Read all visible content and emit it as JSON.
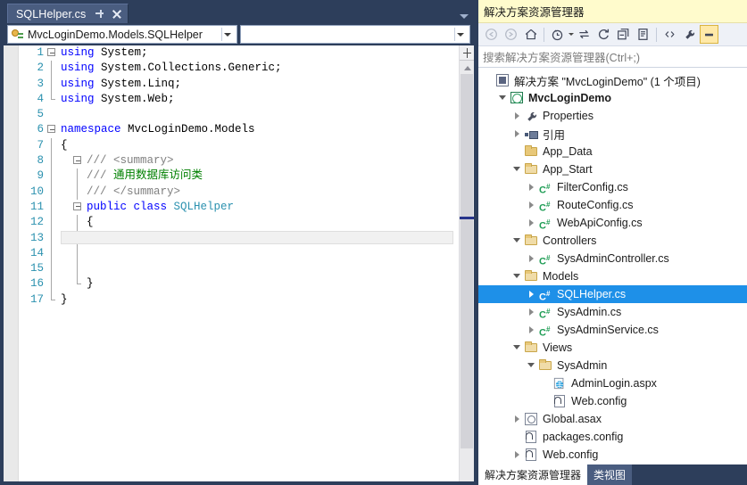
{
  "editor": {
    "tab": {
      "label": "SQLHelper.cs",
      "pin_icon": "pin-icon",
      "close_icon": "close-icon"
    },
    "tabstrip_menu_icon": "chevron-down-icon",
    "nav": {
      "type_combo_value": "MvcLoginDemo.Models.SQLHelper",
      "type_combo_icon": "class-icon",
      "member_combo_value": ""
    },
    "lines": [
      {
        "n": "1",
        "fold": "box",
        "segs": [
          {
            "t": "using ",
            "c": "k"
          },
          {
            "t": "System;",
            "c": "p"
          }
        ]
      },
      {
        "n": "2",
        "fold": "line",
        "segs": [
          {
            "t": "using ",
            "c": "k"
          },
          {
            "t": "System.Collections.Generic;",
            "c": "p"
          }
        ]
      },
      {
        "n": "3",
        "fold": "line",
        "segs": [
          {
            "t": "using ",
            "c": "k"
          },
          {
            "t": "System.Linq;",
            "c": "p"
          }
        ]
      },
      {
        "n": "4",
        "fold": "endline",
        "segs": [
          {
            "t": "using ",
            "c": "k"
          },
          {
            "t": "System.Web;",
            "c": "p"
          }
        ]
      },
      {
        "n": "5",
        "fold": "none",
        "segs": []
      },
      {
        "n": "6",
        "fold": "box",
        "segs": [
          {
            "t": "namespace ",
            "c": "k"
          },
          {
            "t": "MvcLoginDemo.Models",
            "c": "p"
          }
        ]
      },
      {
        "n": "7",
        "fold": "line",
        "segs": [
          {
            "t": "{",
            "c": "p"
          }
        ]
      },
      {
        "n": "8",
        "fold": "line",
        "indent": 1,
        "inner": "box",
        "segs": [
          {
            "t": "/// ",
            "c": "c"
          },
          {
            "t": "<summary>",
            "c": "c"
          }
        ]
      },
      {
        "n": "9",
        "fold": "line",
        "indent": 1,
        "inner": "line",
        "segs": [
          {
            "t": "/// ",
            "c": "c"
          },
          {
            "t": "通用数据库访问类",
            "c": "cg"
          }
        ]
      },
      {
        "n": "10",
        "fold": "line",
        "indent": 1,
        "inner": "line",
        "segs": [
          {
            "t": "/// ",
            "c": "c"
          },
          {
            "t": "</summary>",
            "c": "c"
          }
        ]
      },
      {
        "n": "11",
        "fold": "line",
        "indent": 1,
        "inner": "box",
        "segs": [
          {
            "t": "public ",
            "c": "k"
          },
          {
            "t": "class ",
            "c": "k"
          },
          {
            "t": "SQLHelper",
            "c": "t"
          }
        ]
      },
      {
        "n": "12",
        "fold": "line",
        "indent": 1,
        "inner": "line",
        "segs": [
          {
            "t": "{",
            "c": "p"
          }
        ]
      },
      {
        "n": "13",
        "fold": "line",
        "indent": 1,
        "inner": "line",
        "current": true,
        "segs": []
      },
      {
        "n": "14",
        "fold": "line",
        "indent": 1,
        "inner": "line",
        "segs": []
      },
      {
        "n": "15",
        "fold": "line",
        "indent": 1,
        "inner": "line",
        "segs": []
      },
      {
        "n": "16",
        "fold": "line",
        "indent": 1,
        "inner": "endline",
        "segs": [
          {
            "t": "}",
            "c": "p"
          }
        ]
      },
      {
        "n": "17",
        "fold": "endline",
        "segs": [
          {
            "t": "}",
            "c": "p"
          }
        ]
      }
    ],
    "scrollbar": {
      "split_icon": "split-view-icon",
      "scroll_up_icon": "scroll-up-arrow-icon",
      "marker_label": "changed-line-marker"
    }
  },
  "solution_explorer": {
    "title": "解决方案资源管理器",
    "toolbar": [
      {
        "name": "back-button",
        "icon": "back-arrow-icon",
        "disabled": true,
        "active": false
      },
      {
        "name": "forward-button",
        "icon": "forward-arrow-icon",
        "disabled": true,
        "active": false
      },
      {
        "name": "home-button",
        "icon": "home-icon",
        "disabled": false,
        "active": false
      },
      {
        "name": "pending-changes-button",
        "icon": "clock-icon",
        "disabled": false,
        "active": false,
        "caret": true
      },
      {
        "name": "sync-with-document-button",
        "icon": "sync-arrows-icon",
        "disabled": false,
        "active": false
      },
      {
        "name": "refresh-button",
        "icon": "refresh-icon",
        "disabled": false,
        "active": false
      },
      {
        "name": "collapse-all-button",
        "icon": "collapse-all-icon",
        "disabled": false,
        "active": false
      },
      {
        "name": "show-all-files-button",
        "icon": "show-all-files-icon",
        "disabled": false,
        "active": false
      },
      {
        "name": "view-code-button",
        "icon": "code-brackets-icon",
        "disabled": false,
        "active": false
      },
      {
        "name": "properties-button",
        "icon": "wrench-icon",
        "disabled": false,
        "active": false
      },
      {
        "name": "preview-selected-button",
        "icon": "preview-pane-icon",
        "disabled": false,
        "active": true
      }
    ],
    "search_placeholder": "搜索解决方案资源管理器(Ctrl+;)",
    "tree": [
      {
        "label": "解决方案 \"MvcLoginDemo\" (1 个项目)",
        "icon": "solution-icon",
        "indent": 0,
        "expander": "none",
        "bold": false,
        "selected": false
      },
      {
        "label": "MvcLoginDemo",
        "icon": "project-icon",
        "indent": 1,
        "expander": "open",
        "bold": true,
        "selected": false
      },
      {
        "label": "Properties",
        "icon": "wrench-icon",
        "indent": 2,
        "expander": "closed",
        "bold": false,
        "selected": false
      },
      {
        "label": "引用",
        "icon": "references-icon",
        "indent": 2,
        "expander": "closed",
        "bold": false,
        "selected": false
      },
      {
        "label": "App_Data",
        "icon": "folder-icon",
        "indent": 2,
        "expander": "none",
        "bold": false,
        "selected": false
      },
      {
        "label": "App_Start",
        "icon": "folder-open-icon",
        "indent": 2,
        "expander": "open",
        "bold": false,
        "selected": false
      },
      {
        "label": "FilterConfig.cs",
        "icon": "csharp-file-icon",
        "indent": 3,
        "expander": "closed",
        "bold": false,
        "selected": false
      },
      {
        "label": "RouteConfig.cs",
        "icon": "csharp-file-icon",
        "indent": 3,
        "expander": "closed",
        "bold": false,
        "selected": false
      },
      {
        "label": "WebApiConfig.cs",
        "icon": "csharp-file-icon",
        "indent": 3,
        "expander": "closed",
        "bold": false,
        "selected": false
      },
      {
        "label": "Controllers",
        "icon": "folder-open-icon",
        "indent": 2,
        "expander": "open",
        "bold": false,
        "selected": false
      },
      {
        "label": "SysAdminController.cs",
        "icon": "csharp-file-icon",
        "indent": 3,
        "expander": "closed",
        "bold": false,
        "selected": false
      },
      {
        "label": "Models",
        "icon": "folder-open-icon",
        "indent": 2,
        "expander": "open",
        "bold": false,
        "selected": false
      },
      {
        "label": "SQLHelper.cs",
        "icon": "csharp-file-icon",
        "indent": 3,
        "expander": "closed",
        "bold": false,
        "selected": true
      },
      {
        "label": "SysAdmin.cs",
        "icon": "csharp-file-icon",
        "indent": 3,
        "expander": "closed",
        "bold": false,
        "selected": false
      },
      {
        "label": "SysAdminService.cs",
        "icon": "csharp-file-icon",
        "indent": 3,
        "expander": "closed",
        "bold": false,
        "selected": false
      },
      {
        "label": "Views",
        "icon": "folder-open-icon",
        "indent": 2,
        "expander": "open",
        "bold": false,
        "selected": false
      },
      {
        "label": "SysAdmin",
        "icon": "folder-open-icon",
        "indent": 3,
        "expander": "open",
        "bold": false,
        "selected": false
      },
      {
        "label": "AdminLogin.aspx",
        "icon": "aspx-file-icon",
        "indent": 4,
        "expander": "none",
        "bold": false,
        "selected": false
      },
      {
        "label": "Web.config",
        "icon": "config-file-icon",
        "indent": 4,
        "expander": "none",
        "bold": false,
        "selected": false
      },
      {
        "label": "Global.asax",
        "icon": "asax-file-icon",
        "indent": 2,
        "expander": "closed",
        "bold": false,
        "selected": false
      },
      {
        "label": "packages.config",
        "icon": "config-file-icon",
        "indent": 2,
        "expander": "none",
        "bold": false,
        "selected": false
      },
      {
        "label": "Web.config",
        "icon": "config-file-icon",
        "indent": 2,
        "expander": "closed",
        "bold": false,
        "selected": false
      }
    ],
    "bottom_tabs": [
      {
        "label": "解决方案资源管理器",
        "active": true
      },
      {
        "label": "类视图",
        "active": false
      }
    ]
  },
  "colors": {
    "chrome_navy": "#2d3e5b",
    "tab_active": "#4a5d80",
    "title_yellow": "#fffbcc",
    "selection_blue": "#1e90e8",
    "keyword_blue": "#0000ff",
    "type_teal": "#2b91af",
    "comment_gray": "#808080",
    "comment_green": "#008000",
    "linenumber_teal": "#2b91af"
  }
}
